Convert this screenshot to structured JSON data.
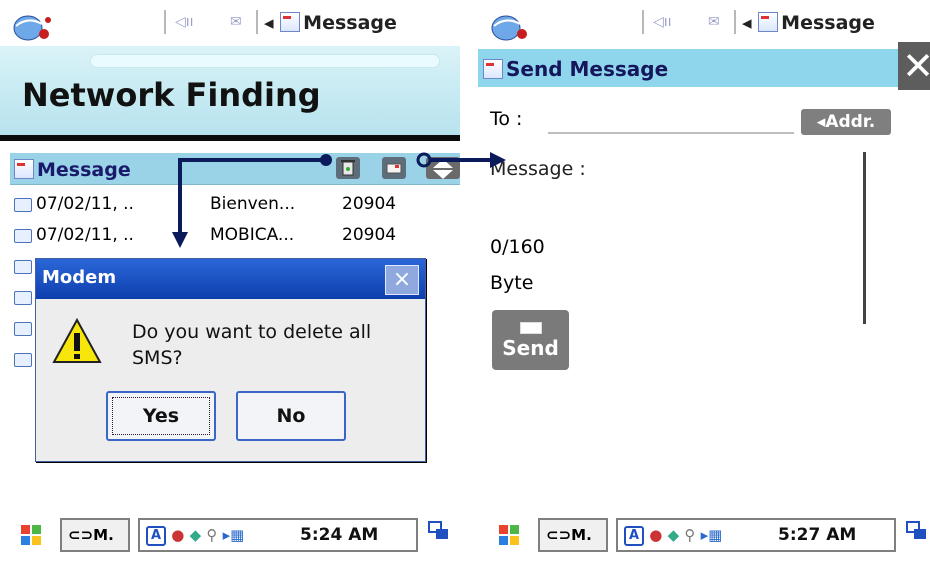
{
  "left": {
    "topbar": {
      "app_title": "Message"
    },
    "banner": {
      "title": "Network Finding"
    },
    "message_bar": {
      "title": "Message"
    },
    "messages": [
      {
        "date": "07/02/11, ..",
        "text": "Bienven...",
        "number": "20904"
      },
      {
        "date": "07/02/11, ..",
        "text": "MOBICA...",
        "number": "20904"
      }
    ],
    "dialog": {
      "title": "Modem",
      "close": "×",
      "text": "Do you want to delete all SMS?",
      "yes": "Yes",
      "no": "No"
    },
    "taskbar": {
      "app": "M.",
      "time": "5:24 AM",
      "input": "A"
    }
  },
  "right": {
    "topbar": {
      "app_title": "Message"
    },
    "send_header": {
      "title": "Send Message",
      "close": "✕"
    },
    "to_label": "To :",
    "addr_button": "Addr.",
    "message_label": "Message :",
    "counter": "0/160",
    "unit": "Byte",
    "send_button": "Send",
    "taskbar": {
      "app": "M.",
      "time": "5:27 AM",
      "input": "A"
    }
  },
  "colors": {
    "accent": "#9ad3e8",
    "dialog_title": "#0e3fae",
    "arrow": "#0a1a5a"
  }
}
